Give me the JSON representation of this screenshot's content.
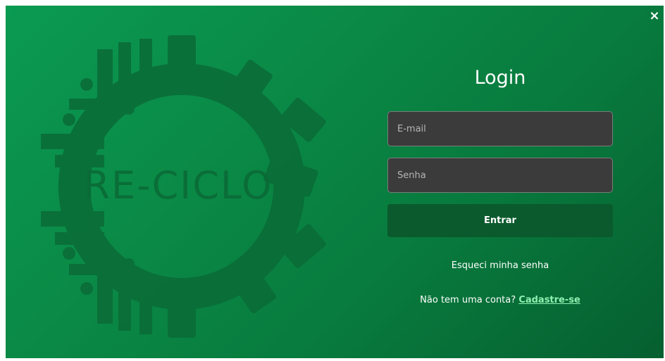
{
  "colors": {
    "background_start": "#0b9a52",
    "background_end": "#065f30",
    "input_bg": "#3b3b3b",
    "button_bg": "#0a5a2d",
    "link_accent": "#8ff0b0"
  },
  "close": {
    "label": "×",
    "icon": "close-icon"
  },
  "logo": {
    "text": "RE-CICLO"
  },
  "login": {
    "title": "Login",
    "email_placeholder": "E-mail",
    "password_placeholder": "Senha",
    "submit_label": "Entrar",
    "forgot_label": "Esqueci minha senha",
    "signup_prompt": "Não tem uma conta?",
    "signup_link": "Cadastre-se"
  }
}
